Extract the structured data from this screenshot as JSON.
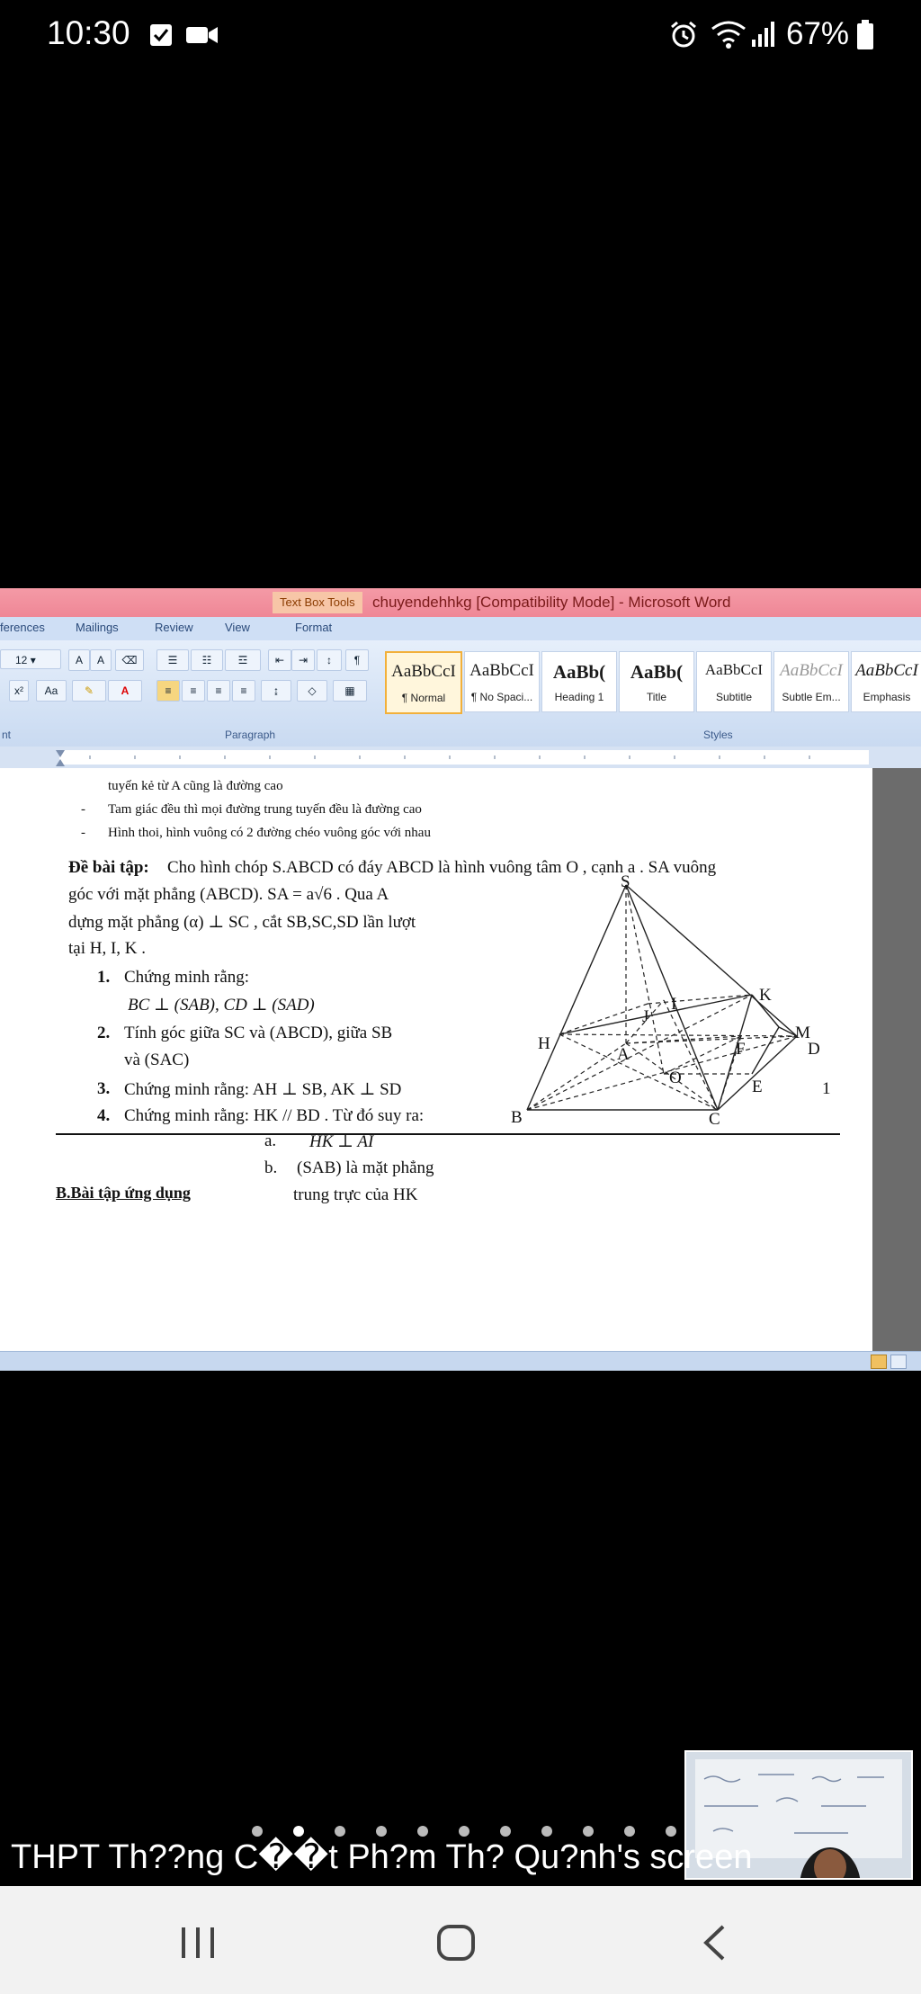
{
  "status_bar": {
    "time": "10:30",
    "battery_percent": "67%",
    "icons": [
      "checkbox-notification-icon",
      "video-camera-icon",
      "alarm-icon",
      "wifi-icon",
      "signal-icon",
      "battery-icon"
    ]
  },
  "word": {
    "contextual_tab": "Text Box Tools",
    "window_title": "chuyendehhkg [Compatibility Mode] - Microsoft Word",
    "tabs": [
      "ferences",
      "Mailings",
      "Review",
      "View",
      "Format"
    ],
    "font_size": "12",
    "group_labels": {
      "font": "nt",
      "paragraph": "Paragraph",
      "styles": "Styles"
    },
    "styles": [
      {
        "sample": "AaBbCcI",
        "name": "¶ Normal"
      },
      {
        "sample": "AaBbCcI",
        "name": "¶ No Spaci..."
      },
      {
        "sample": "AaBb(",
        "name": "Heading 1"
      },
      {
        "sample": "AaBb(",
        "name": "Title"
      },
      {
        "sample": "AaBbCcI",
        "name": "Subtitle"
      },
      {
        "sample": "AaBbCcI",
        "name": "Subtle Em..."
      },
      {
        "sample": "AaBbCcI",
        "name": "Emphasis"
      }
    ],
    "colors": {
      "titlebar": "#f08a98",
      "ribbon": "#dce8f8",
      "selected_style": "#f2b03a"
    }
  },
  "document": {
    "line_0": "tuyến kẻ từ A cũng là đường cao",
    "bullet_1": "Tam giác đều thì mọi đường trung tuyến đều là đường cao",
    "bullet_2": "Hình thoi, hình vuông có 2 đường chéo vuông góc với nhau",
    "problem_label": "Đề bài tập:",
    "problem_l1": "Cho hình chóp S.ABCD có đáy ABCD là hình vuông tâm O , cạnh a . SA vuông",
    "problem_l2": "góc với mặt phẳng (ABCD). SA = a√6 . Qua A",
    "problem_l3": "dựng mặt phẳng (α) ⊥ SC , cắt SB,SC,SD lần lượt",
    "problem_l4": "tại H, I, K .",
    "items": [
      {
        "num": "1.",
        "text": "Chứng minh rằng:",
        "sub": "BC ⊥ (SAB), CD ⊥ (SAD)"
      },
      {
        "num": "2.",
        "text": "Tính góc giữa SC và (ABCD), giữa SB",
        "sub": "và (SAC)"
      },
      {
        "num": "3.",
        "text": "Chứng minh rằng: AH ⊥ SB, AK ⊥ SD",
        "sub": ""
      },
      {
        "num": "4.",
        "text": "Chứng minh rằng: HK // BD . Từ đó suy ra:",
        "sub": ""
      }
    ],
    "sub_a_label": "a.",
    "sub_a_text": "HK ⊥ AI",
    "sub_b_label": "b.",
    "sub_b_text1": "(SAB) là mặt phẳng",
    "sub_b_text2": "trung trực của HK",
    "page_number": "1",
    "section_b": "B.Bài tập ứng dụng",
    "figure_labels": {
      "S": "S",
      "K": "K",
      "I": "I",
      "J": "J",
      "M": "M",
      "H": "H",
      "A": "A",
      "F": "F",
      "D": "D",
      "O": "O",
      "E": "E",
      "B": "B",
      "C": "C"
    }
  },
  "share": {
    "caption": "THPT Th??ng C��t Ph?m Th? Qu?nh's screen"
  },
  "navbar": {
    "icons": [
      "recent-apps-icon",
      "home-icon",
      "back-icon"
    ]
  }
}
